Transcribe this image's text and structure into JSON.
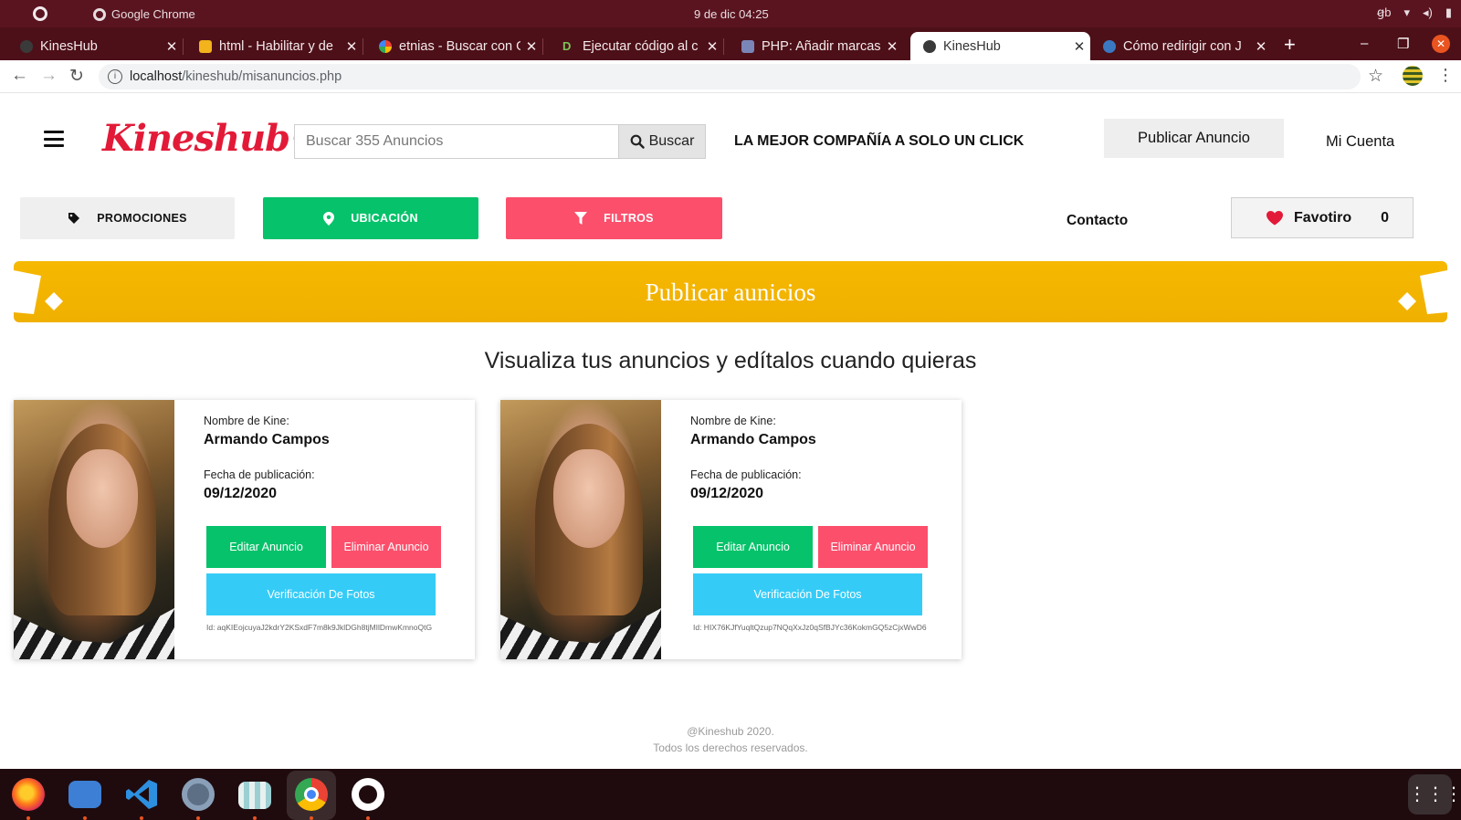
{
  "os": {
    "app_name": "Google Chrome",
    "clock": "9 de dic  04:25",
    "tray": [
      "ꞡb",
      "▾",
      "◂)",
      "▮"
    ]
  },
  "browser": {
    "tabs": [
      {
        "title": "KinesHub",
        "active": false,
        "favicon_color": "#3a3a3a"
      },
      {
        "title": "html - Habilitar y de",
        "active": false,
        "favicon_color": "#f2b31c"
      },
      {
        "title": "etnias - Buscar con G",
        "active": false,
        "favicon_color": "#4285f4"
      },
      {
        "title": "Ejecutar código al c",
        "active": false,
        "favicon_color": "#6ab04c"
      },
      {
        "title": "PHP: Añadir marcas",
        "active": false,
        "favicon_color": "#7a86b8"
      },
      {
        "title": "KinesHub",
        "active": true,
        "favicon_color": "#3a3a3a"
      },
      {
        "title": "Cómo redirigir con J",
        "active": false,
        "favicon_color": "#3a78c2"
      }
    ],
    "url_host": "localhost",
    "url_path": "/kineshub/misanuncios.php"
  },
  "header": {
    "logo_text": "Kineshub",
    "search_placeholder": "Buscar 355 Anuncios",
    "search_button": "Buscar",
    "tagline": "LA MEJOR COMPAÑÍA A SOLO UN CLICK",
    "publish_button": "Publicar Anuncio",
    "account": "Mi Cuenta"
  },
  "filters": {
    "promociones": "PROMOCIONES",
    "ubicacion": "UBICACIÓN",
    "filtros": "FILTROS",
    "contacto": "Contacto",
    "favoritos_label": "Favotiro",
    "favoritos_count": "0"
  },
  "colors": {
    "brand_red": "#e21a38",
    "green": "#06c26a",
    "pink": "#fb4f6c",
    "cyan": "#35cbf7",
    "banner_yellow": "#f6b800"
  },
  "banner": {
    "title": "Publicar aunicios"
  },
  "page_subtitle": "Visualiza tus anuncios y edítalos cuando quieras",
  "ads": [
    {
      "name_label": "Nombre de Kine:",
      "name": "Armando Campos",
      "date_label": "Fecha de publicación:",
      "date": "09/12/2020",
      "edit_label": "Editar Anuncio",
      "delete_label": "Eliminar Anuncio",
      "verify_label": "Verificación De Fotos",
      "id_text": "Id: aqKIEojcuyaJ2kdrY2KSxdF7m8k9JklDGh8tjMIlDmwKmnoQtG"
    },
    {
      "name_label": "Nombre de Kine:",
      "name": "Armando Campos",
      "date_label": "Fecha de publicación:",
      "date": "09/12/2020",
      "edit_label": "Editar Anuncio",
      "delete_label": "Eliminar Anuncio",
      "verify_label": "Verificación De Fotos",
      "id_text": "Id: HIX76KJfYuqltQzup7NQqXxJz0qSfBJYc36KokmGQ5zCjxWwD6"
    }
  ],
  "footer": {
    "line1": "@Kineshub 2020.",
    "line2": "Todos los derechos reservados."
  },
  "dock": {
    "apps": [
      "firefox",
      "files",
      "vscode",
      "settings",
      "videos",
      "chrome",
      "github"
    ]
  }
}
